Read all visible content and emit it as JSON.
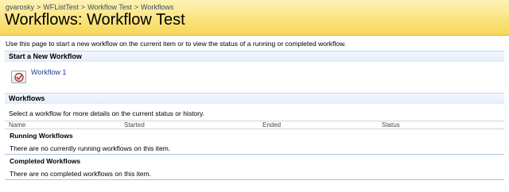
{
  "breadcrumb": {
    "items": [
      "gvarosky",
      "WFListTest",
      "Workflow Test",
      "Workflows"
    ],
    "separator": ">"
  },
  "page_title": "Workflows: Workflow Test",
  "intro_text": "Use this page to start a new workflow on the current item or to view the status of a running or completed workflow.",
  "start_section": {
    "header": "Start a New Workflow",
    "workflows": [
      {
        "label": "Workflow 1",
        "icon": "workflow-check-icon"
      }
    ]
  },
  "workflows_section": {
    "header": "Workflows",
    "description": "Select a workflow for more details on the current status or history.",
    "columns": [
      "Name",
      "Started",
      "Ended",
      "Status"
    ],
    "running": {
      "title": "Running Workflows",
      "empty_message": "There are no currently running workflows on this item."
    },
    "completed": {
      "title": "Completed Workflows",
      "empty_message": "There are no completed workflows on this item."
    }
  },
  "colors": {
    "title_gradient_top": "#fdf2b6",
    "title_gradient_bottom": "#f7d658",
    "section_header_bg": "#e3eefb",
    "link": "#1b3f94",
    "rule": "#a9c4e3"
  }
}
